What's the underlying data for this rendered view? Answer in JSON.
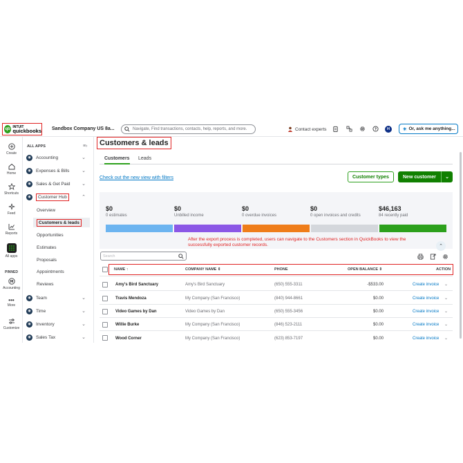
{
  "topbar": {
    "logo_mark": "qb",
    "logo_intuit": "INTUIT",
    "logo_name": "quickbooks",
    "company": "Sandbox Company US 8a...",
    "search_placeholder": "Navigate, Find transactions, contacts, help, reports, and more.",
    "contact_experts": "Contact experts",
    "avatar_initial": "H",
    "ask_label": "Or, ask me anything..."
  },
  "rail": {
    "items": [
      {
        "label": "Create",
        "icon": "plus-circle-icon"
      },
      {
        "label": "Home",
        "icon": "home-icon"
      },
      {
        "label": "Shortcuts",
        "icon": "star-icon"
      },
      {
        "label": "Feed",
        "icon": "sparkle-icon"
      },
      {
        "label": "Reports",
        "icon": "chart-icon"
      },
      {
        "label": "All apps",
        "icon": "grid-icon"
      }
    ],
    "pinned_label": "PINNED",
    "pinned_items": [
      {
        "label": "Accounting",
        "icon": "accounting-icon"
      },
      {
        "label": "More",
        "icon": "more-icon"
      },
      {
        "label": "Customize",
        "icon": "sliders-icon"
      }
    ]
  },
  "nav": {
    "header": "ALL APPS",
    "apps": [
      {
        "label": "Accounting"
      },
      {
        "label": "Expenses & Bills"
      },
      {
        "label": "Sales & Get Paid"
      },
      {
        "label": "Customer Hub"
      }
    ],
    "sub_items": [
      {
        "label": "Overview"
      },
      {
        "label": "Customers & leads"
      },
      {
        "label": "Opportunities"
      },
      {
        "label": "Estimates"
      },
      {
        "label": "Proposals"
      },
      {
        "label": "Appointments"
      },
      {
        "label": "Reviews"
      }
    ],
    "apps_bottom": [
      {
        "label": "Team"
      },
      {
        "label": "Time"
      },
      {
        "label": "Inventory"
      },
      {
        "label": "Sales Tax"
      }
    ]
  },
  "main": {
    "title": "Customers & leads",
    "tabs": [
      {
        "label": "Customers"
      },
      {
        "label": "Leads"
      }
    ],
    "filters_link": "Check out the new view with filters",
    "customer_types_button": "Customer types",
    "new_customer_button": "New customer",
    "summary": [
      {
        "value": "$0",
        "label": "0 estimates",
        "color": "#6cb4f0"
      },
      {
        "value": "$0",
        "label": "Unbilled income",
        "color": "#8b57e6"
      },
      {
        "value": "$0",
        "label": "0 overdue invoices",
        "color": "#ef7d1a"
      },
      {
        "value": "$0",
        "label": "0 open invoices and credits",
        "color": "#d4d7dc"
      },
      {
        "value": "$46,163",
        "label": "84 recently paid",
        "color": "#2ca01c"
      }
    ],
    "annotation": "After the export process is completed, users can navigate to the Customers section in QuickBooks to view the successfully exported customer records.",
    "table_search_placeholder": "Search",
    "columns": {
      "name": "NAME",
      "name_sort": "↑",
      "company": "COMPANY NAME",
      "company_sort": "⇕",
      "phone": "PHONE",
      "balance": "OPEN BALANCE",
      "balance_sort": "⇕",
      "action": "ACTION"
    },
    "rows": [
      {
        "name": "Amy's Bird Sanctuary",
        "company": "Amy's Bird Sanctuary",
        "phone": "(650) 555-3311",
        "balance": "-$533.00",
        "action": "Create invoice"
      },
      {
        "name": "Travis Mendoza",
        "company": "My Company (San Francisco)",
        "phone": "(840) 944-8661",
        "balance": "$0.00",
        "action": "Create invoice"
      },
      {
        "name": "Video Games by Dan",
        "company": "Video Games by Dan",
        "phone": "(650) 555-3456",
        "balance": "$0.00",
        "action": "Create invoice"
      },
      {
        "name": "Willie Burke",
        "company": "My Company (San Francisco)",
        "phone": "(846) 523-2111",
        "balance": "$0.00",
        "action": "Create invoice"
      },
      {
        "name": "Wood Corner",
        "company": "My Company (San Francisco)",
        "phone": "(623) 853-7197",
        "balance": "$0.00",
        "action": "Create invoice"
      }
    ]
  }
}
